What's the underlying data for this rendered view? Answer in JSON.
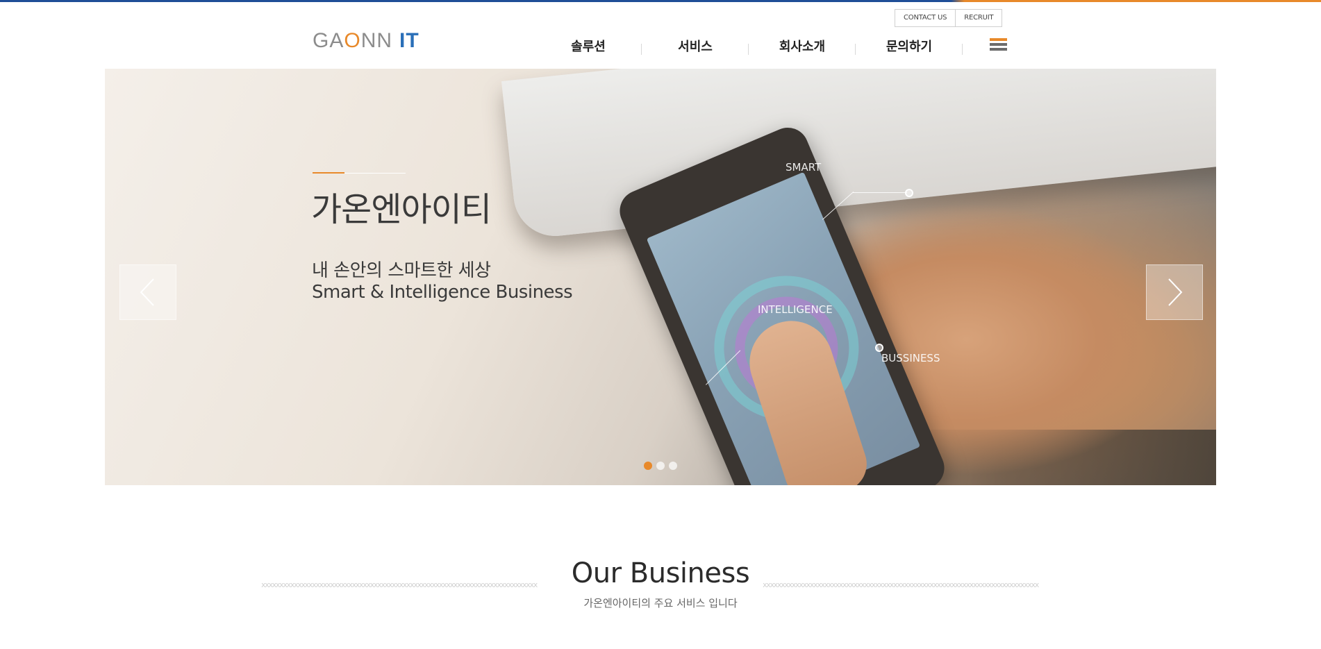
{
  "utility_links": [
    "CONTACT US",
    "RECRUIT"
  ],
  "logo": {
    "part1": "GA",
    "part2": "O",
    "part3": "NN",
    "part4": "IT"
  },
  "nav": {
    "items": [
      "솔루션",
      "서비스",
      "회사소개",
      "문의하기"
    ]
  },
  "hero": {
    "title": "가온엔아이티",
    "subtitle_ko": "내 손안의 스마트한 세상",
    "subtitle_en": "Smart & Intelligence Business",
    "overlay_labels": [
      "SMART",
      "INTELLIGENCE",
      "BUSSINESS"
    ],
    "slide_count": 3,
    "active_slide": 1
  },
  "section": {
    "title": "Our Business",
    "subtitle": "가온엔아이티의 주요 서비스 입니다"
  },
  "colors": {
    "accent": "#e8892a",
    "brand_blue": "#1f4e97",
    "logo_gray": "#8c8c8c"
  },
  "icons": [
    "menu-icon",
    "chevron-left-icon",
    "chevron-right-icon"
  ]
}
